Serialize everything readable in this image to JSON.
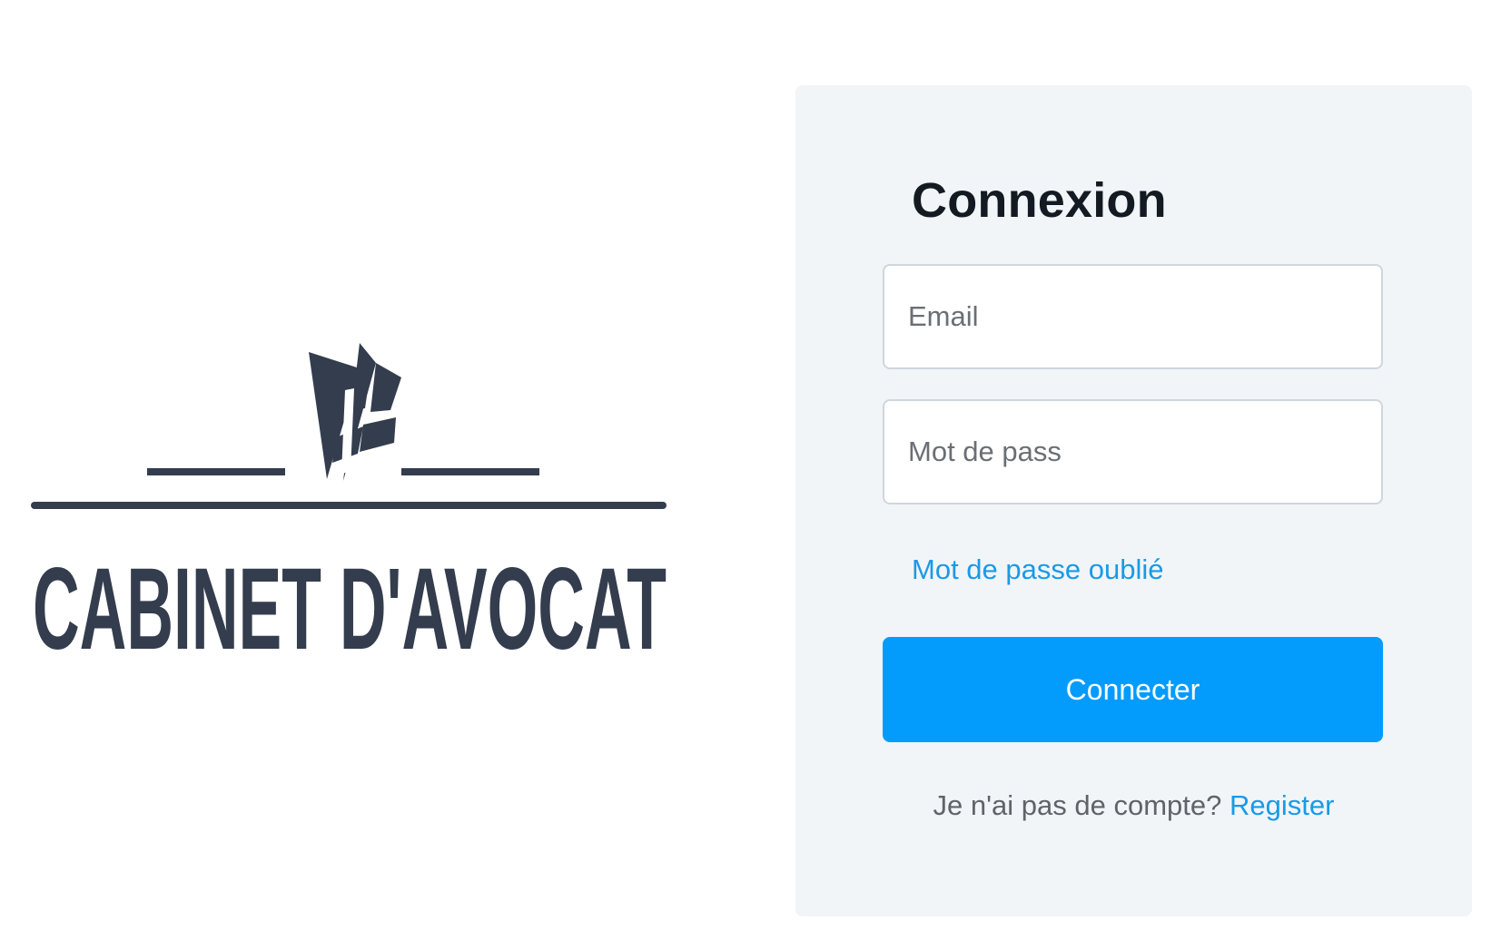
{
  "brand": {
    "logo_text": "CABINET D'AVOCAT",
    "logo_color": "#343d4e"
  },
  "login": {
    "title": "Connexion",
    "email_placeholder": "Email",
    "password_placeholder": "Mot de pass",
    "forgot_label": "Mot de passe oublié",
    "submit_label": "Connecter",
    "no_account_text": "Je n'ai pas de compte?",
    "register_label": "Register"
  },
  "colors": {
    "accent": "#039cfd",
    "link": "#1a9ae6",
    "card_bg": "#f1f5f8",
    "title": "#141a22"
  }
}
